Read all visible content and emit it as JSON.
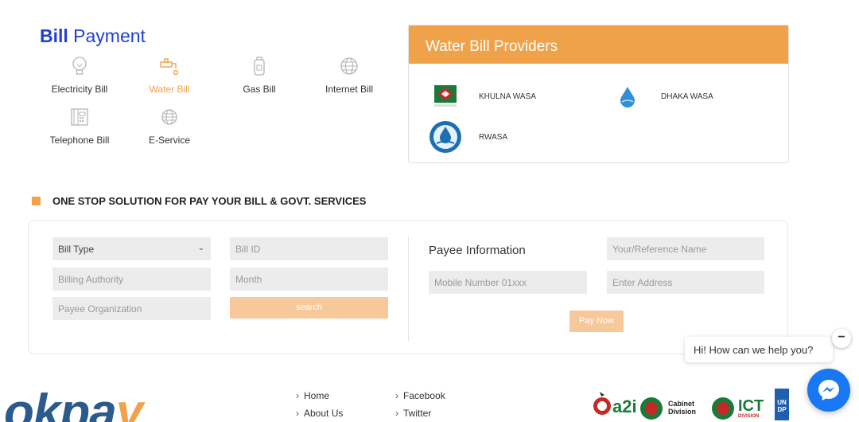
{
  "bill_payment": {
    "title_bold": "Bill",
    "title_rest": " Payment",
    "categories": [
      {
        "label": "Electricity Bill",
        "icon": "bulb-icon"
      },
      {
        "label": "Water Bill",
        "icon": "water-tap-icon",
        "active": true
      },
      {
        "label": "Gas Bill",
        "icon": "gas-cylinder-icon"
      },
      {
        "label": "Internet Bill",
        "icon": "globe-icon"
      },
      {
        "label": "Telephone Bill",
        "icon": "telephone-icon"
      },
      {
        "label": "E-Service",
        "icon": "globe-icon"
      }
    ]
  },
  "providers": {
    "title": "Water Bill Providers",
    "items": [
      {
        "name": "KHULNA WASA",
        "icon": "khulna-wasa-logo"
      },
      {
        "name": "DHAKA WASA",
        "icon": "dhaka-wasa-logo"
      },
      {
        "name": "RWASA",
        "icon": "rwasa-logo"
      }
    ]
  },
  "section": {
    "title": "ONE STOP SOLUTION FOR PAY YOUR BILL & GOVT. SERVICES"
  },
  "form": {
    "bill_type": "Bill Type",
    "bill_id_placeholder": "Bill ID",
    "billing_authority_placeholder": "Billing Authority",
    "month_placeholder": "Month",
    "payee_org_placeholder": "Payee Organization",
    "search_label": "search",
    "payee_info_title": "Payee Information",
    "reference_name_placeholder": "Your/Reference Name",
    "mobile_placeholder": "Mobile Number 01xxx",
    "address_placeholder": "Enter Address",
    "pay_now_label": "Pay Now"
  },
  "chat": {
    "message": "Hi! How can we help you?",
    "minimize": "−"
  },
  "footer": {
    "brand_main": "okpa",
    "brand_accent": "y",
    "links": [
      "Home",
      "About Us",
      "Facebook",
      "Twitter"
    ],
    "partners": [
      {
        "name": "a2i",
        "text": "a2i"
      },
      {
        "name": "Cabinet Division",
        "text1": "Cabinet",
        "text2": "Division"
      },
      {
        "name": "ICT Division",
        "text1": "ICT",
        "text2": "DIVISION"
      },
      {
        "name": "UNDP",
        "text1": "UN",
        "text2": "DP"
      }
    ]
  },
  "colors": {
    "accent": "#f0a24b",
    "brand_blue": "#1f3fd6",
    "button_light": "#f7c89a",
    "messenger": "#1877f2"
  }
}
